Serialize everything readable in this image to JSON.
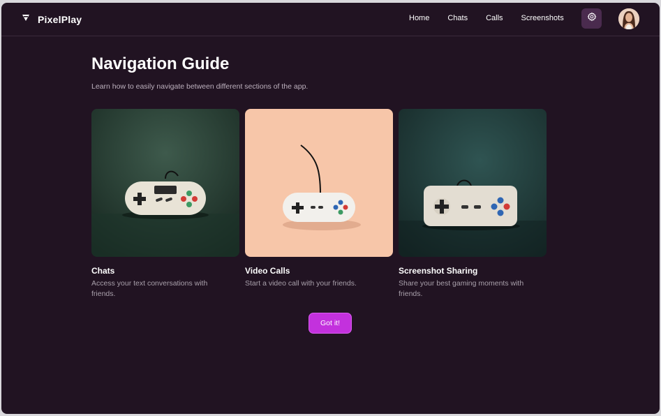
{
  "app": {
    "name": "PixelPlay",
    "logo_icon": "logo-icon"
  },
  "nav": {
    "links": [
      "Home",
      "Chats",
      "Calls",
      "Screenshots"
    ],
    "settings_icon": "gear-icon"
  },
  "page": {
    "title": "Navigation Guide",
    "subtitle": "Learn how to easily navigate between different sections of the app."
  },
  "cards": [
    {
      "title": "Chats",
      "description": "Access your text conversations with friends.",
      "image": "controller-photo-dark-green"
    },
    {
      "title": "Video Calls",
      "description": "Start a video call with your friends.",
      "image": "controller-photo-peach"
    },
    {
      "title": "Screenshot Sharing",
      "description": "Share your best gaming moments with friends.",
      "image": "controller-photo-teal"
    }
  ],
  "cta": {
    "label": "Got it!"
  },
  "colors": {
    "background": "#211322",
    "accent": "#c331dd",
    "settings_bg": "#4a2b4e"
  }
}
